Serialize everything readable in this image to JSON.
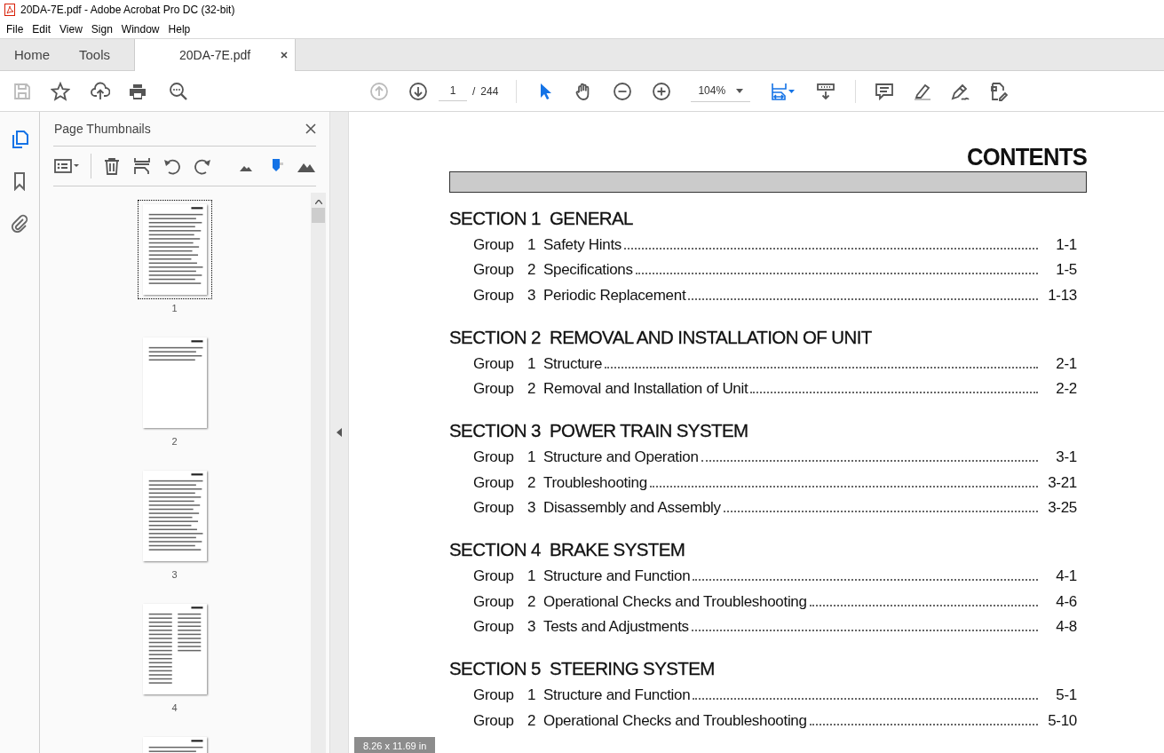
{
  "window": {
    "title": "20DA-7E.pdf - Adobe Acrobat Pro DC (32-bit)"
  },
  "menu": [
    "File",
    "Edit",
    "View",
    "Sign",
    "Window",
    "Help"
  ],
  "tabs": [
    {
      "label": "Home",
      "selected": false,
      "kind": "app"
    },
    {
      "label": "Tools",
      "selected": false,
      "kind": "app"
    },
    {
      "label": "20DA-7E.pdf",
      "selected": true,
      "kind": "document"
    }
  ],
  "toolbar": {
    "page_number": "1",
    "page_separator": "/",
    "page_count": "244",
    "zoom": "104%"
  },
  "sidebar": {
    "items": [
      {
        "kind": "pages",
        "selected": true
      },
      {
        "kind": "bookmarks",
        "selected": false
      },
      {
        "kind": "attachments",
        "selected": false
      }
    ]
  },
  "thumbnail_panel": {
    "title": "Page Thumbnails",
    "thumbnails": [
      {
        "label": "1",
        "selected": true
      },
      {
        "label": "2",
        "selected": false
      },
      {
        "label": "3",
        "selected": false
      },
      {
        "label": "4",
        "selected": false
      },
      {
        "selected": false
      }
    ]
  },
  "document": {
    "heading": "CONTENTS",
    "sections": [
      {
        "title": "SECTION 1  GENERAL",
        "groups": [
          {
            "label": "Group",
            "number": "1",
            "title": "Safety Hints",
            "page": "1-1"
          },
          {
            "label": "Group",
            "number": "2",
            "title": "Specifications",
            "page": "1-5"
          },
          {
            "label": "Group",
            "number": "3",
            "title": "Periodic Replacement",
            "page": "1-13"
          }
        ]
      },
      {
        "title": "SECTION 2  REMOVAL AND INSTALLATION OF UNIT",
        "groups": [
          {
            "label": "Group",
            "number": "1",
            "title": "Structure",
            "page": "2-1"
          },
          {
            "label": "Group",
            "number": "2",
            "title": "Removal and Installation of Unit",
            "page": "2-2"
          }
        ]
      },
      {
        "title": "SECTION 3  POWER TRAIN SYSTEM",
        "groups": [
          {
            "label": "Group",
            "number": "1",
            "title": "Structure and Operation",
            "page": "3-1"
          },
          {
            "label": "Group",
            "number": "2",
            "title": "Troubleshooting",
            "page": "3-21"
          },
          {
            "label": "Group",
            "number": "3",
            "title": "Disassembly and Assembly",
            "page": "3-25"
          }
        ]
      },
      {
        "title": "SECTION 4  BRAKE SYSTEM",
        "groups": [
          {
            "label": "Group",
            "number": "1",
            "title": "Structure and Function",
            "page": "4-1"
          },
          {
            "label": "Group",
            "number": "2",
            "title": "Operational Checks and Troubleshooting",
            "page": "4-6"
          },
          {
            "label": "Group",
            "number": "3",
            "title": "Tests and Adjustments",
            "page": "4-8"
          }
        ]
      },
      {
        "title": "SECTION 5  STEERING SYSTEM",
        "groups": [
          {
            "label": "Group",
            "number": "1",
            "title": "Structure and Function",
            "page": "5-1"
          },
          {
            "label": "Group",
            "number": "2",
            "title": "Operational Checks and Troubleshooting",
            "page": "5-10"
          }
        ]
      }
    ]
  },
  "status": {
    "page_size": "8.26 x 11.69 in"
  }
}
